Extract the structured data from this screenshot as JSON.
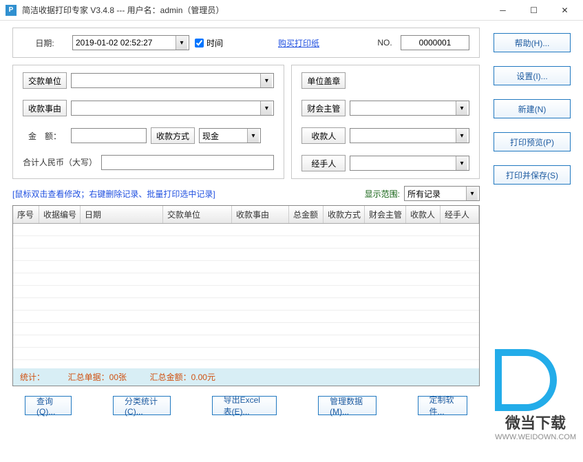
{
  "title": "简洁收据打印专家 V3.4.8 --- 用户名：admin（管理员）",
  "top": {
    "date_label": "日期:",
    "date_value": "2019-01-02 02:52:27",
    "time_checkbox_label": "时间",
    "buy_paper_link": "购买打印纸",
    "no_label": "NO.",
    "no_value": "0000001"
  },
  "form": {
    "payer_label": "交款单位",
    "reason_label": "收款事由",
    "amount_label": "金　额：",
    "pay_method_label": "收款方式",
    "pay_method_value": "现金",
    "amount_cn_label": "合计人民币（大写）",
    "stamp_label": "单位盖章",
    "supervisor_label": "财会主管",
    "payee_label": "收款人",
    "handler_label": "经手人"
  },
  "hint": "[鼠标双击查看修改；右键删除记录、批量打印选中记录]",
  "range_label": "显示范围:",
  "range_value": "所有记录",
  "grid": {
    "cols": [
      "序号",
      "收据编号",
      "日期",
      "交款单位",
      "收款事由",
      "总金额",
      "收款方式",
      "财会主管",
      "收款人",
      "经手人"
    ]
  },
  "summary": {
    "label": "统计：",
    "count": "汇总单据：00张",
    "amount": "汇总金额：0.00元"
  },
  "side_buttons": {
    "help": "帮助(H)...",
    "settings": "设置(I)...",
    "new": "新建(N)",
    "preview": "打印预览(P)",
    "print_save": "打印并保存(S)"
  },
  "bottom_buttons": {
    "query": "查询(Q)...",
    "category": "分类统计(C)...",
    "export": "导出Excel表(E)...",
    "manage": "管理数据(M)...",
    "custom": "定制软件..."
  },
  "watermark": {
    "text": "微当下载",
    "url": "WWW.WEIDOWN.COM"
  }
}
